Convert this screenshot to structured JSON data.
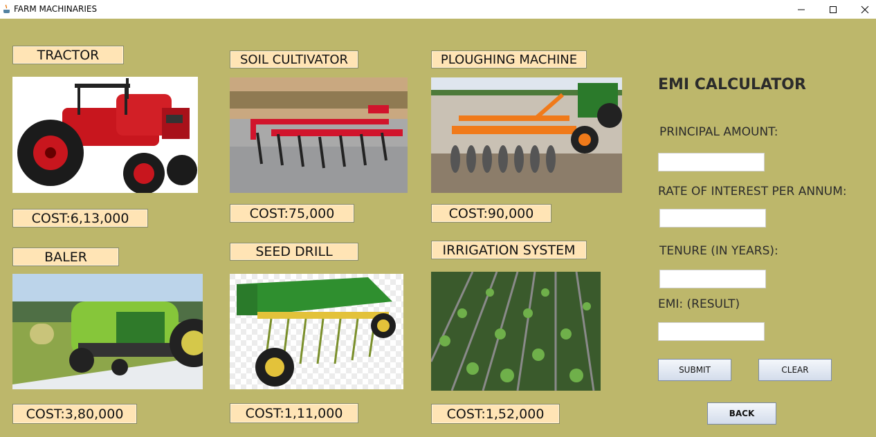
{
  "window": {
    "title": "FARM MACHINARIES",
    "minimize": "—",
    "maximize": "☐",
    "close": "✕"
  },
  "machines": [
    {
      "name": "TRACTOR",
      "cost": "COST:6,13,000",
      "image": "tractor"
    },
    {
      "name": "SOIL CULTIVATOR",
      "cost": "COST:75,000",
      "image": "soil-cultivator"
    },
    {
      "name": "PLOUGHING MACHINE",
      "cost": "COST:90,000",
      "image": "ploughing-machine"
    },
    {
      "name": "BALER",
      "cost": "COST:3,80,000",
      "image": "baler"
    },
    {
      "name": "SEED DRILL",
      "cost": "COST:1,11,000",
      "image": "seed-drill"
    },
    {
      "name": "IRRIGATION SYSTEM",
      "cost": "COST:1,52,000",
      "image": "irrigation-system"
    }
  ],
  "emi": {
    "title": "EMI CALCULATOR",
    "principal_label": "PRINCIPAL AMOUNT:",
    "principal_value": "",
    "rate_label": "RATE OF INTEREST PER ANNUM:",
    "rate_value": "",
    "tenure_label": "TENURE (IN YEARS):",
    "tenure_value": "",
    "result_label": "EMI: (RESULT)",
    "result_value": "",
    "submit_label": "SUBMIT",
    "clear_label": "CLEAR",
    "back_label": "BACK"
  },
  "colors": {
    "background": "#bdb76b",
    "label_fill": "#ffe4b5"
  }
}
